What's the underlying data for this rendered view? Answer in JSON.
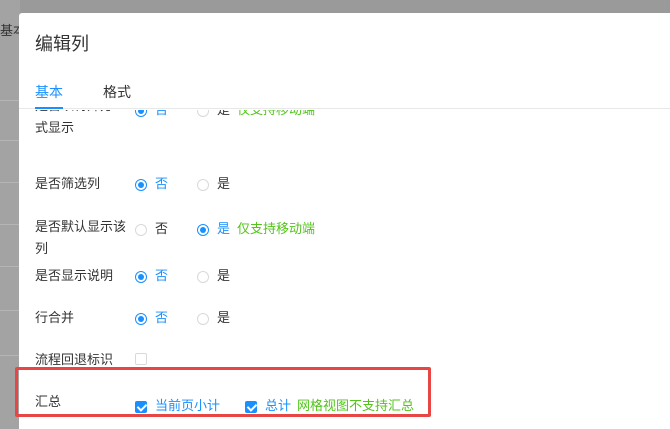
{
  "background": {
    "partial_text": "基本"
  },
  "modal": {
    "title": "编辑列",
    "tabs": [
      {
        "label": "基本",
        "active": true
      },
      {
        "label": "格式",
        "active": false
      }
    ],
    "rows": {
      "mobile_display": {
        "label_line1": "是否以特殊方",
        "label_line2": "式显示",
        "no": "否",
        "yes": "是",
        "hint": "仅支持移动端"
      },
      "filter": {
        "label": "是否筛选列",
        "no": "否",
        "yes": "是"
      },
      "default_show": {
        "label_line1": "是否默认显示该",
        "label_line2": "列",
        "no": "否",
        "yes": "是",
        "hint": "仅支持移动端"
      },
      "show_desc": {
        "label": "是否显示说明",
        "no": "否",
        "yes": "是"
      },
      "row_merge": {
        "label": "行合并",
        "no": "否",
        "yes": "是"
      },
      "rollback_flag": {
        "label": "流程回退标识"
      },
      "summary": {
        "label": "汇总",
        "page_subtotal": "当前页小计",
        "total": "总计",
        "hint": "网格视图不支持汇总"
      }
    }
  },
  "colors": {
    "accent": "#1890ff",
    "hint_green": "#52c41a",
    "highlight_red": "#e84545"
  }
}
